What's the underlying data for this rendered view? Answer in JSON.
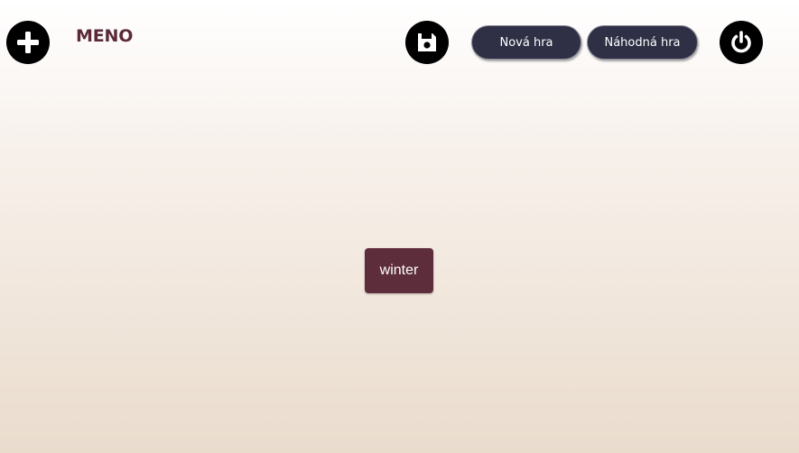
{
  "header": {
    "menu_title": "MENO",
    "new_game_label": "Nová hra",
    "random_game_label": "Náhodná hra",
    "icons": {
      "add": "plus-icon",
      "save": "save-icon",
      "power": "power-icon"
    }
  },
  "board": {
    "tiles": [
      {
        "word": "winter"
      }
    ]
  },
  "colors": {
    "icon_button": "#000000",
    "pill_button": "#2f3045",
    "menu_title": "#5b2a3a",
    "tile": "#5e2d3c"
  }
}
